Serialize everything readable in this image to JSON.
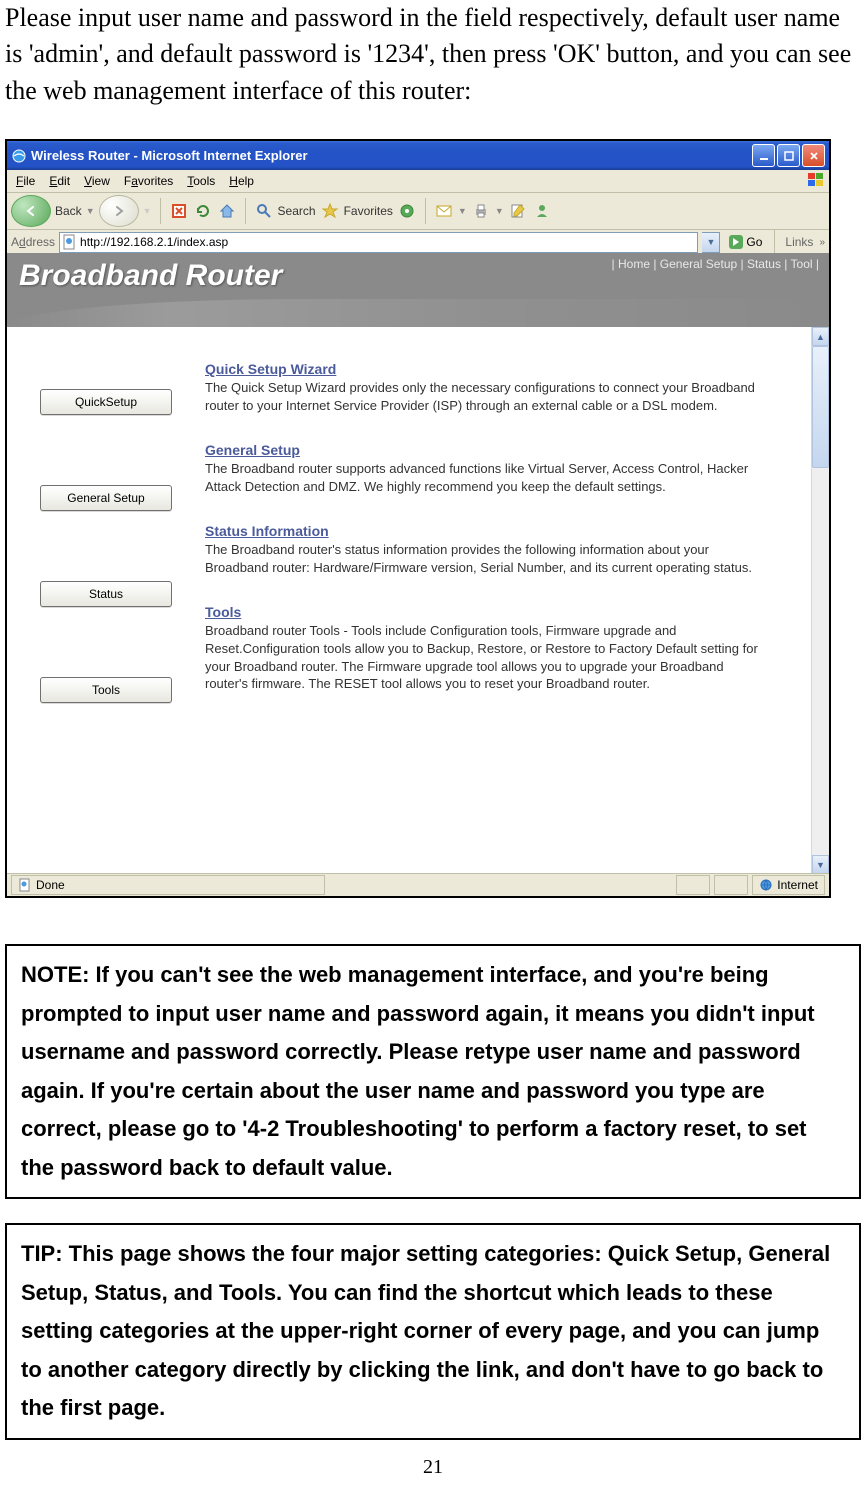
{
  "intro": "Please input user name and password in the field respectively, default user name is 'admin', and default password is '1234', then press 'OK' button, and you can see the web management interface of this router:",
  "browser": {
    "title": "Wireless Router - Microsoft Internet Explorer",
    "menus": {
      "file": "File",
      "edit": "Edit",
      "view": "View",
      "favorites": "Favorites",
      "tools": "Tools",
      "help": "Help"
    },
    "toolbar": {
      "back": "Back",
      "search": "Search",
      "favorites": "Favorites"
    },
    "address_label": "Address",
    "address_value": "http://192.168.2.1/index.asp",
    "go_label": "Go",
    "links_label": "Links",
    "status_done": "Done",
    "status_zone": "Internet"
  },
  "router": {
    "brand": "Broadband Router",
    "top_links": "| Home | General Setup | Status | Tool |",
    "side_buttons": {
      "quicksetup": "QuickSetup",
      "generalsetup": "General Setup",
      "status": "Status",
      "tools": "Tools"
    },
    "sections": {
      "quick": {
        "title": "Quick Setup Wizard",
        "desc": "The Quick Setup Wizard provides only the necessary configurations to connect your Broadband router to your Internet Service Provider (ISP) through an external cable or a DSL modem."
      },
      "general": {
        "title": "General Setup",
        "desc": "The Broadband router supports advanced functions like Virtual Server, Access Control, Hacker Attack Detection and DMZ. We highly recommend you keep the default settings."
      },
      "status": {
        "title": "Status Information",
        "desc": "The Broadband router's status information provides the following information about your Broadband router: Hardware/Firmware version, Serial Number, and its current operating status."
      },
      "tools": {
        "title": "Tools",
        "desc": "Broadband router Tools - Tools include Configuration tools, Firmware upgrade and Reset.Configuration tools allow you to Backup, Restore, or Restore to Factory Default setting for your Broadband router. The Firmware upgrade tool allows you to upgrade your Broadband router's firmware. The RESET tool allows you to reset your Broadband router."
      }
    }
  },
  "note": "NOTE: If you can't see the web management interface, and you're being prompted to input user name and password again, it means you didn't input username and password correctly. Please retype user name and password again. If you're certain about the user name and password you type are correct, please go to '4-2 Troubleshooting' to perform a factory reset, to set the password back to default value.",
  "tip": "TIP: This page shows the four major setting categories: Quick Setup, General Setup, Status, and Tools. You can find the shortcut which leads to these setting categories at the upper-right corner of every page, and you can jump to another category directly by clicking the link, and don't have to go back to the first page.",
  "page_number": "21"
}
